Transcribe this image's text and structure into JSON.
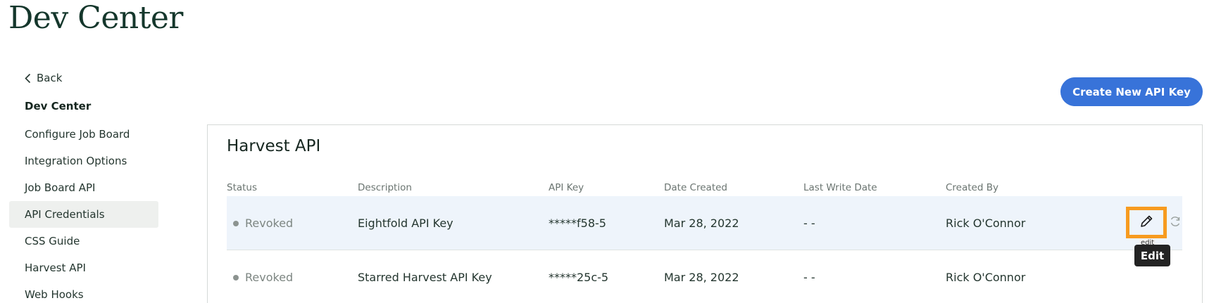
{
  "header": {
    "title": "Dev Center"
  },
  "sidebar": {
    "back_label": "Back",
    "section_title": "Dev Center",
    "items": [
      {
        "label": "Configure Job Board",
        "active": false
      },
      {
        "label": "Integration Options",
        "active": false
      },
      {
        "label": "Job Board API",
        "active": false
      },
      {
        "label": "API Credentials",
        "active": true
      },
      {
        "label": "CSS Guide",
        "active": false
      },
      {
        "label": "Harvest API",
        "active": false
      },
      {
        "label": "Web Hooks",
        "active": false
      }
    ]
  },
  "actions": {
    "create_label": "Create New API Key"
  },
  "card": {
    "title": "Harvest API",
    "columns": [
      "Status",
      "Description",
      "API Key",
      "Date Created",
      "Last Write Date",
      "Created By"
    ],
    "rows": [
      {
        "status": "Revoked",
        "description": "Eightfold API Key",
        "api_key": "*****f58-5",
        "date_created": "Mar 28, 2022",
        "last_write": "- -",
        "created_by": "Rick O'Connor"
      },
      {
        "status": "Revoked",
        "description": "Starred Harvest API Key",
        "api_key": "*****25c-5",
        "date_created": "Mar 28, 2022",
        "last_write": "- -",
        "created_by": "Rick O'Connor"
      }
    ],
    "edit_small_tooltip": "edit",
    "edit_tooltip": "Edit"
  },
  "colors": {
    "accent": "#3873d9",
    "highlight_row": "#eef4fb",
    "focus_outline": "#f79b1f"
  },
  "icons": {
    "back": "chevron-left-icon",
    "edit": "pencil-icon",
    "refresh": "refresh-icon"
  }
}
